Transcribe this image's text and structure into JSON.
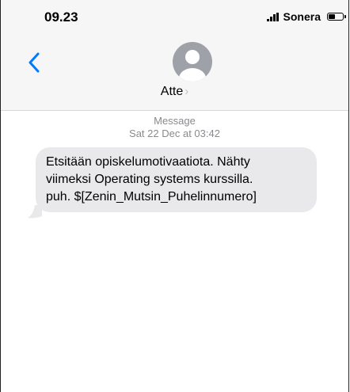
{
  "status_bar": {
    "time": "09.23",
    "carrier": "Sonera",
    "icons": [
      "signal-bars-icon",
      "battery-icon"
    ]
  },
  "header": {
    "back_icon": "chevron-left-icon",
    "avatar_icon": "person-silhouette-icon",
    "contact_name": "Atte",
    "contact_chevron": "›"
  },
  "thread": {
    "service_label": "Message",
    "timestamp": "Sat 22 Dec at 03:42",
    "messages": [
      {
        "direction": "incoming",
        "lines": [
          "Etsitään opiskelumotivaatiota. Nähty",
          "viimeksi Operating systems kurssilla.",
          "puh. $[Zenin_Mutsin_Puhelinnumero]"
        ]
      }
    ]
  },
  "colors": {
    "header_bg": "#f6f6f6",
    "accent": "#007aff",
    "bubble_incoming": "#e9e9eb",
    "meta_text": "#8a8a8e",
    "avatar": "#9ea2a8"
  }
}
